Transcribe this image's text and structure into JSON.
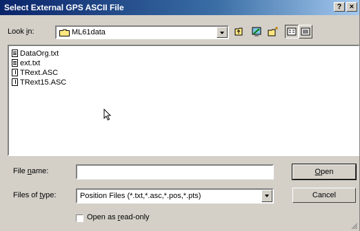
{
  "window": {
    "title": "Select External GPS ASCII File",
    "help_glyph": "?",
    "close_glyph": "×"
  },
  "look_in": {
    "label_pre": "Look ",
    "label_key": "i",
    "label_post": "n:",
    "value": "ML61data",
    "icon": "folder-icon"
  },
  "toolbar": {
    "buttons": [
      "up-one-level-icon",
      "desktop-icon",
      "new-folder-icon",
      "list-view-icon",
      "details-view-icon"
    ]
  },
  "files": [
    {
      "name": "DataOrg.txt",
      "type": "txt",
      "icon": "text-file-icon"
    },
    {
      "name": "ext.txt",
      "type": "txt",
      "icon": "text-file-icon"
    },
    {
      "name": "TRext.ASC",
      "type": "asc",
      "icon": "asc-file-icon"
    },
    {
      "name": "TRext15.ASC",
      "type": "asc",
      "icon": "asc-file-icon"
    }
  ],
  "file_name": {
    "label_pre": "File ",
    "label_key": "n",
    "label_post": "ame:",
    "value": ""
  },
  "file_type": {
    "label_pre": "Files of ",
    "label_key": "t",
    "label_post": "ype:",
    "value": "Position Files (*.txt,*.asc,*.pos,*.pts)"
  },
  "buttons": {
    "open_key": "O",
    "open_rest": "pen",
    "cancel": "Cancel"
  },
  "read_only": {
    "label_pre": "Open as ",
    "label_key": "r",
    "label_post": "ead-only",
    "checked": false
  },
  "colors": {
    "title_gradient_start": "#0a246a",
    "title_gradient_end": "#a6caf0",
    "face": "#d4d0c8"
  }
}
